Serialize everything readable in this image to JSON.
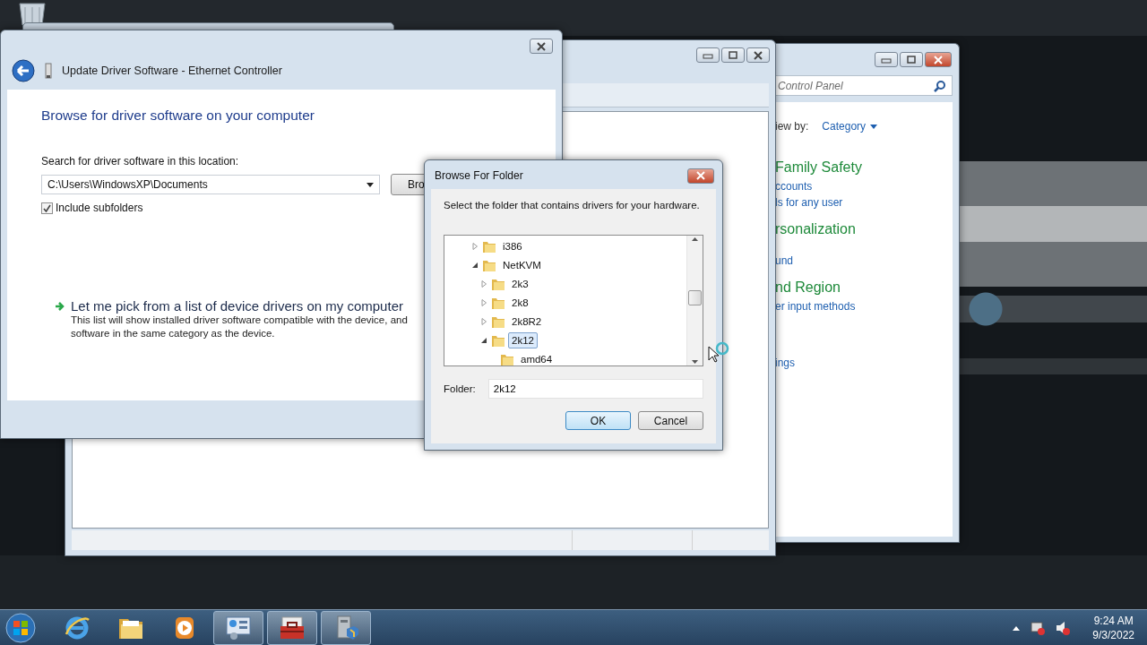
{
  "update_driver": {
    "title": "Update Driver Software - Ethernet Controller",
    "heading": "Browse for driver software on your computer",
    "location_label": "Search for driver software in this location:",
    "location_value": "C:\\Users\\WindowsXP\\Documents",
    "browse_button": "Bro",
    "include_subfolders": {
      "label": "Include subfolders",
      "checked": true
    },
    "pick_link": "Let me pick from a list of device drivers on my computer",
    "pick_description": [
      "This list will show installed driver software compatible with the device, and",
      "software in the same category as the device."
    ]
  },
  "browse_dialog": {
    "title": "Browse For Folder",
    "instruction": "Select the folder that contains drivers for your hardware.",
    "tree": [
      {
        "label": "i386",
        "expanded": false,
        "selected": false
      },
      {
        "label": "NetKVM",
        "expanded": true,
        "selected": false,
        "children": [
          {
            "label": "2k3",
            "expanded": false,
            "selected": false
          },
          {
            "label": "2k8",
            "expanded": false,
            "selected": false
          },
          {
            "label": "2k8R2",
            "expanded": false,
            "selected": false
          },
          {
            "label": "2k12",
            "expanded": true,
            "selected": true,
            "children": [
              {
                "label": "amd64",
                "selected": false
              }
            ]
          }
        ]
      }
    ],
    "folder_label": "Folder:",
    "folder_value": "2k12",
    "buttons": [
      {
        "label": "OK",
        "default": true
      },
      {
        "label": "Cancel",
        "default": false
      }
    ]
  },
  "control_panel": {
    "search_placeholder": "Control Panel",
    "view_by_label": "iew by:",
    "view_by_value": "Category",
    "sections": [
      {
        "title": "Family Safety",
        "links": [
          "ccounts",
          "ls for any user"
        ]
      },
      {
        "title": "rsonalization",
        "links": [
          "und"
        ]
      },
      {
        "title": "nd Region",
        "links": [
          "er input methods"
        ]
      },
      {
        "links": [
          "ings"
        ]
      }
    ]
  },
  "taskbar": {
    "items": [
      {
        "kind": "start"
      },
      {
        "kind": "browser",
        "open": false
      },
      {
        "kind": "folder",
        "open": false
      },
      {
        "kind": "media",
        "open": false
      },
      {
        "kind": "control-panel",
        "open": true
      },
      {
        "kind": "toolbox",
        "open": true
      },
      {
        "kind": "device-manager",
        "open": true
      }
    ],
    "clock": {
      "time": "9:24 AM",
      "date": "9/3/2022"
    }
  }
}
